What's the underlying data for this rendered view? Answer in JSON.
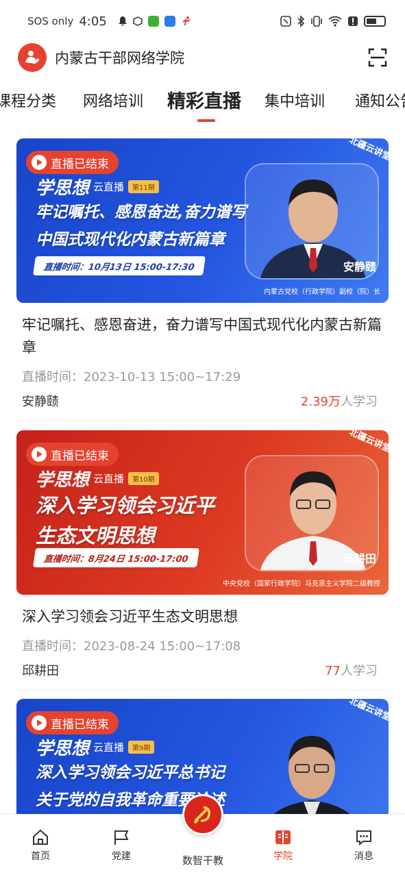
{
  "status_bar": {
    "carrier": "SOS only",
    "time": "4:05"
  },
  "header": {
    "title": "内蒙古干部网络学院"
  },
  "tabs": [
    {
      "label": "课程分类"
    },
    {
      "label": "网络培训"
    },
    {
      "label": "精彩直播"
    },
    {
      "label": "集中培训"
    },
    {
      "label": "通知公告"
    }
  ],
  "cards": [
    {
      "badge": "直播已结束",
      "banner_corner": "北疆云讲堂",
      "banner_series": "学思想",
      "banner_series_suffix": "云直播",
      "banner_issue": "第11期",
      "banner_headline_1": "牢记嘱托、感恩奋进,奋力谱写",
      "banner_headline_2": "中国式现代化内蒙古新篇章",
      "banner_time": "直播时间：10月13日 15:00-17:30",
      "banner_name": "安静赜",
      "banner_affiliation": "内蒙古党校（行政学院）副校（院）长",
      "title": "牢记嘱托、感恩奋进，奋力谱写中国式现代化内蒙古新篇章",
      "time": "直播时间：2023-10-13 15:00~17:29",
      "speaker": "安静赜",
      "learners": "2.39万",
      "learners_suffix": "人学习"
    },
    {
      "badge": "直播已结束",
      "banner_corner": "北疆云讲堂",
      "banner_series": "学思想",
      "banner_series_suffix": "云直播",
      "banner_issue": "第10期",
      "banner_headline_1": "深入学习领会习近平",
      "banner_headline_2": "生态文明思想",
      "banner_time": "直播时间：8月24日 15:00-17:00",
      "banner_name": "邱耕田",
      "banner_affiliation": "中央党校（国家行政学院）马克思主义学院二级教授",
      "title": "深入学习领会习近平生态文明思想",
      "time": "直播时间：2023-08-24 15:00~17:08",
      "speaker": "邱耕田",
      "learners": "77",
      "learners_suffix": "人学习"
    },
    {
      "badge": "直播已结束",
      "banner_corner": "北疆云讲堂",
      "banner_series": "学思想",
      "banner_series_suffix": "云直播",
      "banner_issue": "第9期",
      "banner_headline_1": "深入学习领会习近平总书记",
      "banner_headline_2": "关于党的自我革命重要论述"
    }
  ],
  "bottom_nav": [
    {
      "label": "首页",
      "icon": "home-icon"
    },
    {
      "label": "党建",
      "icon": "flag-icon"
    },
    {
      "label": "数智干教",
      "icon": "party-emblem-icon"
    },
    {
      "label": "学院",
      "icon": "book-icon"
    },
    {
      "label": "消息",
      "icon": "message-icon"
    }
  ],
  "colors": {
    "accent": "#e4432f",
    "banner_blue": "#2456e0",
    "banner_red": "#d8301f"
  }
}
